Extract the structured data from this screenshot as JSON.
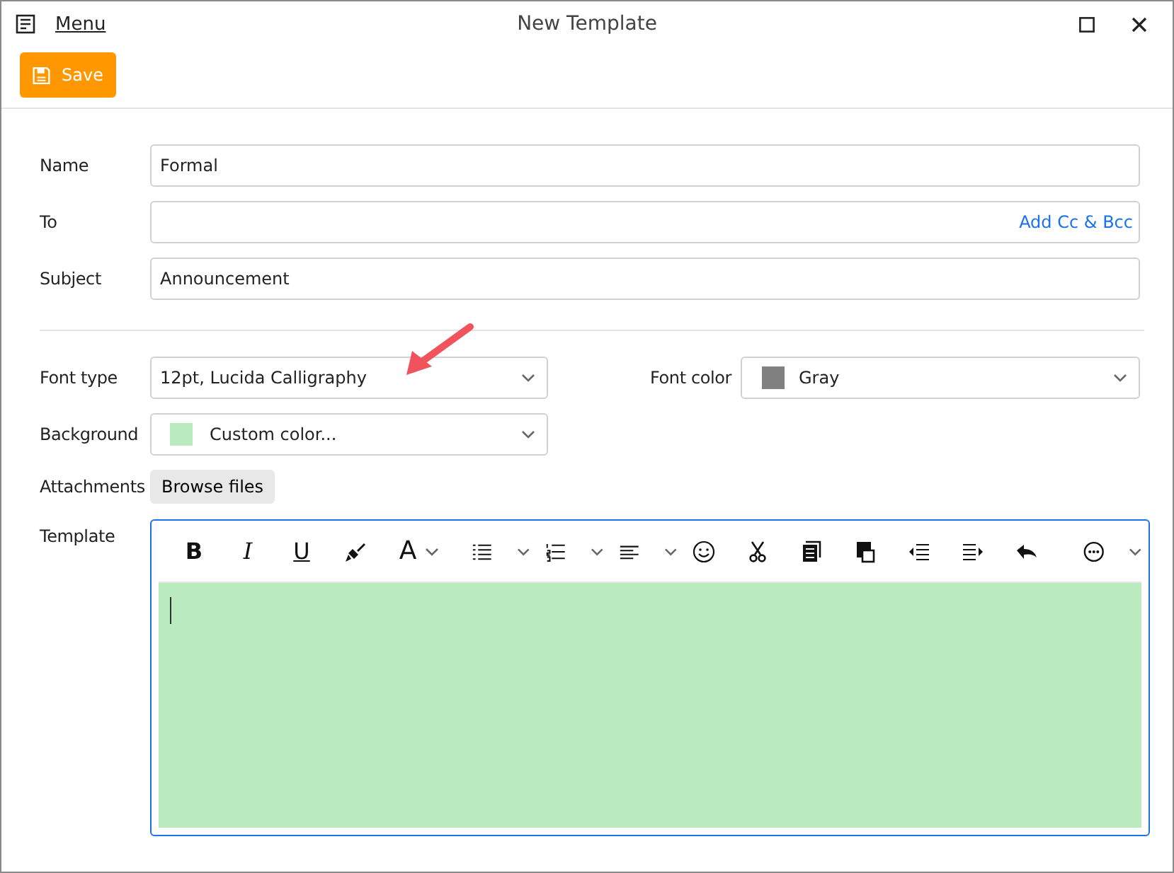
{
  "window": {
    "title": "New Template",
    "menu": "Menu"
  },
  "toolbar": {
    "save": "Save"
  },
  "fields": [
    {
      "label": "Name",
      "value": "Formal"
    },
    {
      "label": "To",
      "link": "Add Cc & Bcc"
    },
    {
      "label": "Subject",
      "value": "Announcement"
    }
  ],
  "font_type": {
    "label": "Font type",
    "value": "12pt, Lucida Calligraphy"
  },
  "font_color": {
    "label": "Font color",
    "value": "Gray",
    "color": "#808080"
  },
  "background": {
    "label": "Background",
    "value": "Custom color...",
    "color": "#b9ebbe"
  },
  "attachments": {
    "label": "Attachments",
    "button": "Browse files"
  },
  "template": {
    "label": "Template",
    "format_buttons": [
      "B",
      "I",
      "U",
      "A"
    ]
  }
}
